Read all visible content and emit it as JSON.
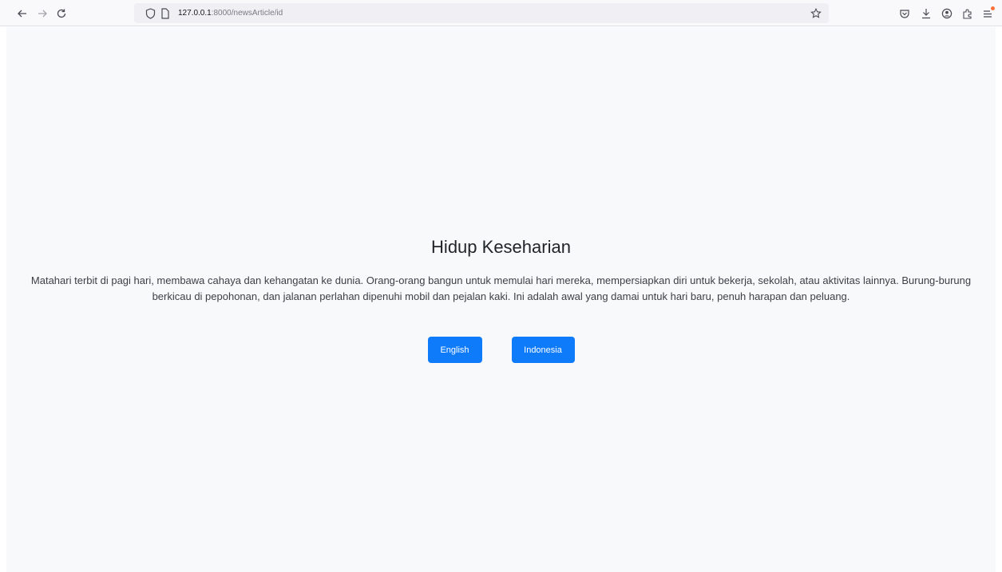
{
  "browser": {
    "url_host": "127.0.0.1",
    "url_path": ":8000/newsArticle/id",
    "icons": [
      "back-arrow-icon",
      "forward-arrow-icon",
      "reload-icon",
      "tracking-shield-icon",
      "page-icon",
      "bookmark-star-icon",
      "pocket-icon",
      "download-icon",
      "account-icon",
      "extensions-icon",
      "menu-icon"
    ],
    "accent_color": "#ff7139"
  },
  "article": {
    "title": "Hidup Keseharian",
    "body": "Matahari terbit di pagi hari, membawa cahaya dan kehangatan ke dunia. Orang-orang bangun untuk memulai hari mereka, mempersiapkan diri untuk bekerja, sekolah, atau aktivitas lainnya. Burung-burung berkicau di pepohonan, dan jalanan perlahan dipenuhi mobil dan pejalan kaki. Ini adalah awal yang damai untuk hari baru, penuh harapan dan peluang."
  },
  "buttons": {
    "english_label": "English",
    "indonesia_label": "Indonesia",
    "color": "#0d7bfa"
  }
}
